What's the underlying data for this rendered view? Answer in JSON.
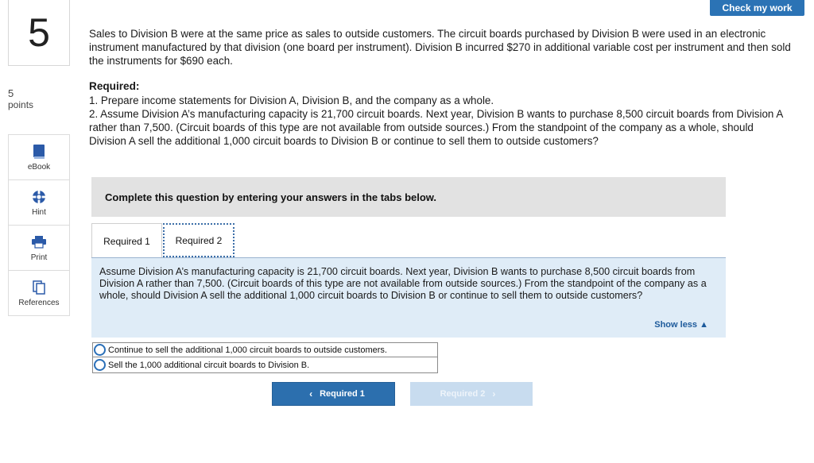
{
  "question": {
    "number": "5",
    "points_value": "5",
    "points_label": "points"
  },
  "tools": [
    {
      "label": "eBook",
      "icon": "book-icon"
    },
    {
      "label": "Hint",
      "icon": "lifebuoy-icon"
    },
    {
      "label": "Print",
      "icon": "printer-icon"
    },
    {
      "label": "References",
      "icon": "documents-icon"
    }
  ],
  "header": {
    "check_label": "Check my work"
  },
  "prompt": {
    "text": "Sales to Division B were at the same price as sales to outside customers. The circuit boards purchased by Division B were used in an electronic instrument manufactured by that division (one board per instrument). Division B incurred $270 in additional variable cost per instrument and then sold the instruments for $690 each."
  },
  "required": {
    "heading": "Required:",
    "items": [
      "1. Prepare income statements for Division A, Division B, and the company as a whole.",
      "2. Assume Division A’s manufacturing capacity is 21,700 circuit boards. Next year, Division B wants to purchase 8,500 circuit boards from Division A rather than 7,500. (Circuit boards of this type are not available from outside sources.) From the standpoint of the company as a whole, should Division A sell the additional 1,000 circuit boards to Division B or continue to sell them to outside customers?"
    ]
  },
  "instruction": "Complete this question by entering your answers in the tabs below.",
  "tabs": [
    {
      "label": "Required 1",
      "active": false
    },
    {
      "label": "Required 2",
      "active": true
    }
  ],
  "panel": {
    "text": "Assume Division A’s manufacturing capacity is 21,700 circuit boards. Next year, Division B wants to purchase 8,500 circuit boards from Division A rather than 7,500. (Circuit boards of this type are not available from outside sources.) From the standpoint of the company as a whole, should Division A sell the additional 1,000 circuit boards to Division B or continue to sell them to outside customers?",
    "toggle_label": "Show less ▲"
  },
  "options": [
    {
      "label": "Continue to sell the additional 1,000 circuit boards to outside customers.",
      "selected": false
    },
    {
      "label": "Sell the 1,000 additional circuit boards to Division B.",
      "selected": false
    }
  ],
  "navigation": {
    "prev_label": "Required 1",
    "next_label": "Required 2"
  },
  "colors": {
    "accent": "#2b73b5",
    "panel_bg": "#dfecf7",
    "header_bg": "#e2e2e2",
    "disabled_btn": "#c8dcef"
  }
}
